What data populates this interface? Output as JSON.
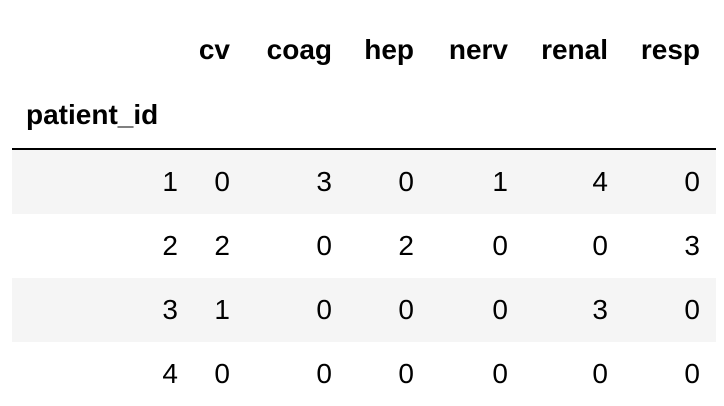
{
  "table": {
    "columns": [
      "cv",
      "coag",
      "hep",
      "nerv",
      "renal",
      "resp"
    ],
    "index_name": "patient_id",
    "rows": [
      {
        "index": "1",
        "values": [
          "0",
          "3",
          "0",
          "1",
          "4",
          "0"
        ]
      },
      {
        "index": "2",
        "values": [
          "2",
          "0",
          "2",
          "0",
          "0",
          "3"
        ]
      },
      {
        "index": "3",
        "values": [
          "1",
          "0",
          "0",
          "0",
          "3",
          "0"
        ]
      },
      {
        "index": "4",
        "values": [
          "0",
          "0",
          "0",
          "0",
          "0",
          "0"
        ]
      }
    ]
  }
}
